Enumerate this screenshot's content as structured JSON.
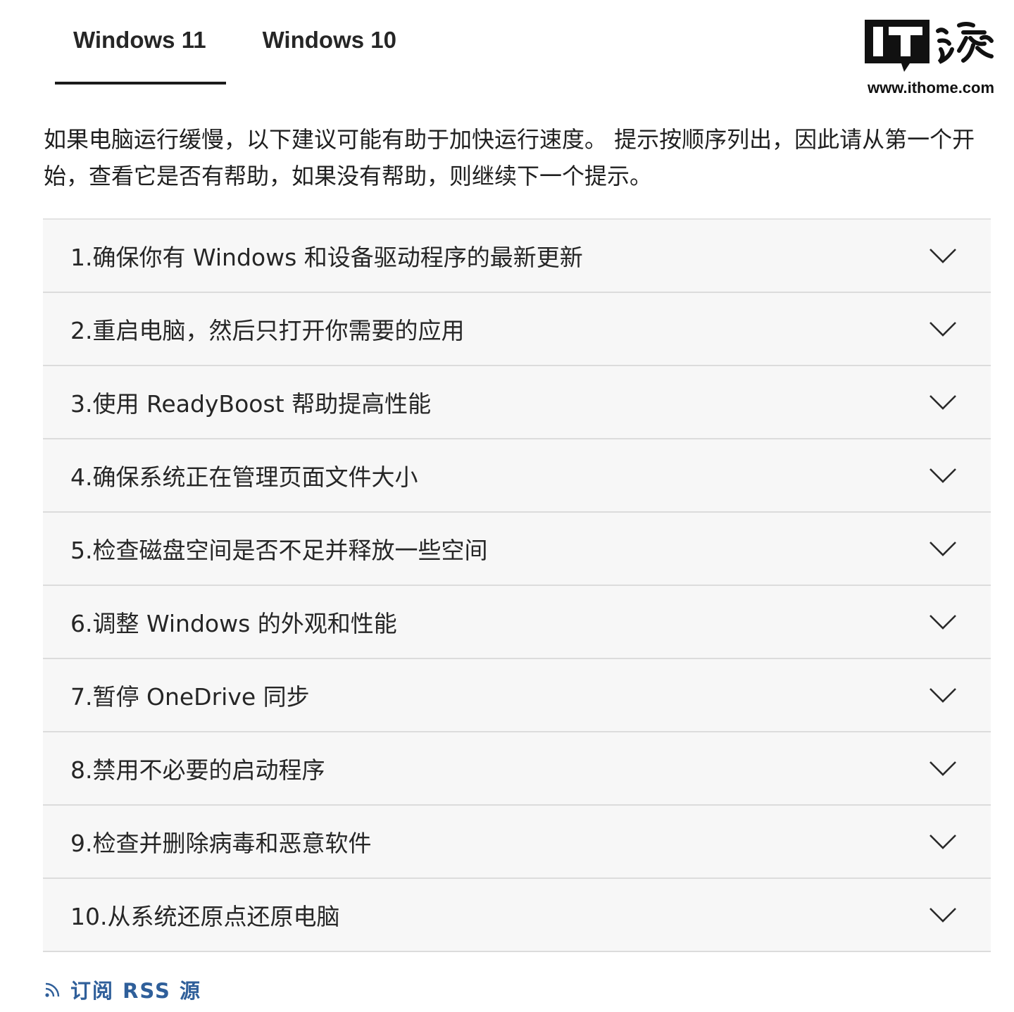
{
  "tabs": [
    {
      "label": "Windows 11",
      "active": true
    },
    {
      "label": "Windows 10",
      "active": false
    }
  ],
  "logo": {
    "brand": "IT之家",
    "url": "www.ithome.com"
  },
  "intro": "如果电脑运行缓慢，以下建议可能有助于加快运行速度。 提示按顺序列出，因此请从第一个开始，查看它是否有帮助，如果没有帮助，则继续下一个提示。",
  "accordion": [
    "1.确保你有 Windows 和设备驱动程序的最新更新",
    "2.重启电脑，然后只打开你需要的应用",
    "3.使用 ReadyBoost 帮助提高性能",
    "4.确保系统正在管理页面文件大小",
    "5.检查磁盘空间是否不足并释放一些空间",
    "6.调整 Windows 的外观和性能",
    "7.暂停 OneDrive 同步",
    "8.禁用不必要的启动程序",
    "9.检查并删除病毒和恶意软件",
    "10.从系统还原点还原电脑"
  ],
  "rss": {
    "label": "订阅 RSS 源",
    "icon": "rss-icon"
  },
  "colors": {
    "link": "#2f5f9a",
    "row_bg": "#f7f7f7",
    "divider": "#dcdcdc"
  }
}
